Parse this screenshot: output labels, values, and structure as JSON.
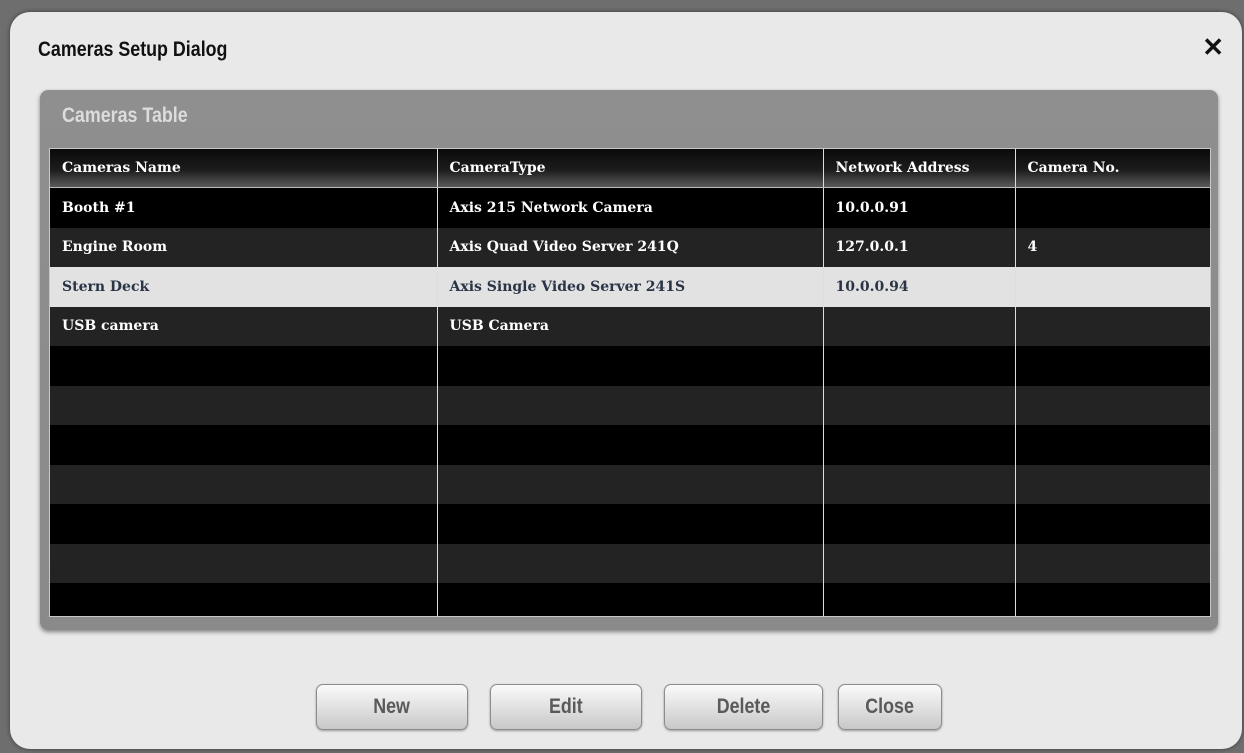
{
  "dialog": {
    "title": "Cameras Setup Dialog",
    "close_glyph": "✕"
  },
  "panel": {
    "title": "Cameras Table"
  },
  "table": {
    "columns": [
      "Cameras Name",
      "CameraType",
      "Network Address",
      "Camera No."
    ],
    "rows": [
      [
        "Booth #1",
        "Axis 215 Network Camera",
        "10.0.0.91",
        ""
      ],
      [
        "Engine Room",
        "Axis Quad Video Server 241Q",
        "127.0.0.1",
        "4"
      ],
      [
        "Stern Deck",
        "Axis Single Video Server 241S",
        "10.0.0.94",
        ""
      ],
      [
        "USB camera",
        "USB Camera",
        "",
        ""
      ]
    ],
    "selected_row": 2,
    "empty_rows": 7
  },
  "buttons": {
    "new_label": "New",
    "edit_label": "Edit",
    "delete_label": "Delete",
    "close_label": "Close"
  },
  "colors": {
    "row_odd": "#000000",
    "row_even": "#232323",
    "row_selected": "#e2e2e2",
    "panel": "#8c8c8c",
    "dialog": "#e9e9e9"
  }
}
